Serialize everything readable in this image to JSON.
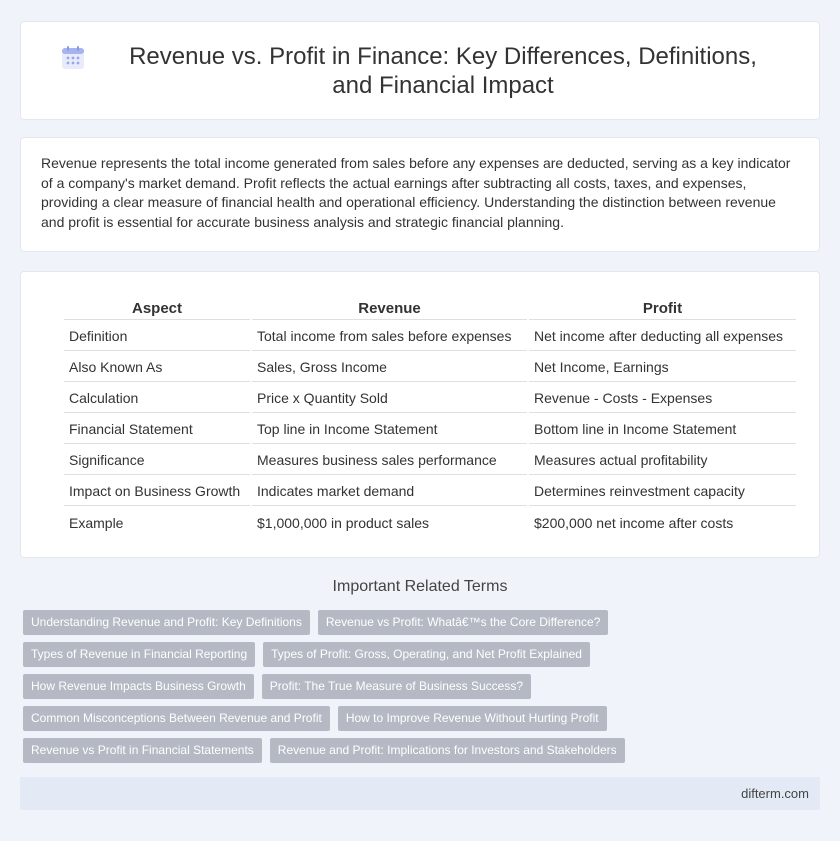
{
  "header": {
    "title": "Revenue vs. Profit in Finance: Key Differences, Definitions, and Financial Impact",
    "icon": "calendar-icon"
  },
  "intro": {
    "text": "Revenue represents the total income generated from sales before any expenses are deducted, serving as a key indicator of a company's market demand. Profit reflects the actual earnings after subtracting all costs, taxes, and expenses, providing a clear measure of financial health and operational efficiency. Understanding the distinction between revenue and profit is essential for accurate business analysis and strategic financial planning."
  },
  "table": {
    "headers": [
      "Aspect",
      "Revenue",
      "Profit"
    ],
    "rows": [
      [
        "Definition",
        "Total income from sales before expenses",
        "Net income after deducting all expenses"
      ],
      [
        "Also Known As",
        "Sales, Gross Income",
        "Net Income, Earnings"
      ],
      [
        "Calculation",
        "Price x Quantity Sold",
        "Revenue - Costs - Expenses"
      ],
      [
        "Financial Statement",
        "Top line in Income Statement",
        "Bottom line in Income Statement"
      ],
      [
        "Significance",
        "Measures business sales performance",
        "Measures actual profitability"
      ],
      [
        "Impact on Business Growth",
        "Indicates market demand",
        "Determines reinvestment capacity"
      ],
      [
        "Example",
        "$1,000,000 in product sales",
        "$200,000 net income after costs"
      ]
    ]
  },
  "related": {
    "heading": "Important Related Terms",
    "tags": [
      "Understanding Revenue and Profit: Key Definitions",
      "Revenue vs Profit: Whatâ€™s the Core Difference?",
      "Types of Revenue in Financial Reporting",
      "Types of Profit: Gross, Operating, and Net Profit Explained",
      "How Revenue Impacts Business Growth",
      "Profit: The True Measure of Business Success?",
      "Common Misconceptions Between Revenue and Profit",
      "How to Improve Revenue Without Hurting Profit",
      "Revenue vs Profit in Financial Statements",
      "Revenue and Profit: Implications for Investors and Stakeholders"
    ]
  },
  "footer": {
    "site": "difterm.com"
  },
  "colors": {
    "background": "#f0f3f9",
    "tag": "#b4b9c3",
    "footer": "#e4eaf5",
    "icon_accent": "#7b8fe0"
  }
}
